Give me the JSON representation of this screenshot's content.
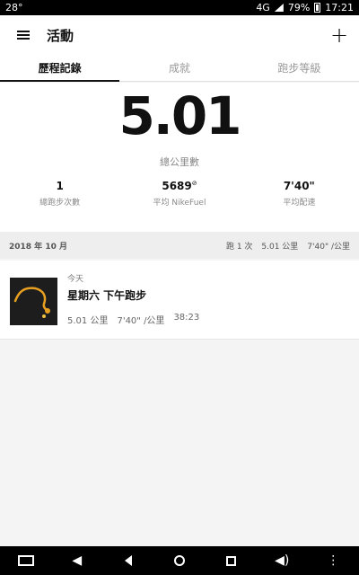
{
  "status": {
    "temp": "28°",
    "network": "4G",
    "battery": "79%",
    "time": "17:21"
  },
  "app_bar": {
    "title": "活動"
  },
  "tabs": [
    {
      "label": "歷程記錄",
      "active": true
    },
    {
      "label": "成就",
      "active": false
    },
    {
      "label": "跑步等級",
      "active": false
    }
  ],
  "summary": {
    "total_distance": "5.01",
    "total_distance_label": "總公里數",
    "stats": [
      {
        "value": "1",
        "label": "總跑步次數"
      },
      {
        "value": "5689",
        "value_sup": "⊘",
        "label": "平均 NikeFuel"
      },
      {
        "value": "7'40\"",
        "label": "平均配速"
      }
    ]
  },
  "month": {
    "title": "2018 年 10 月",
    "runs": "跑 1 次",
    "distance": "5.01 公里",
    "pace": "7'40\" /公里"
  },
  "run": {
    "day": "今天",
    "title": "星期六 下午跑步",
    "distance": "5.01 公里",
    "pace": "7'40\" /公里",
    "duration": "38:23"
  }
}
